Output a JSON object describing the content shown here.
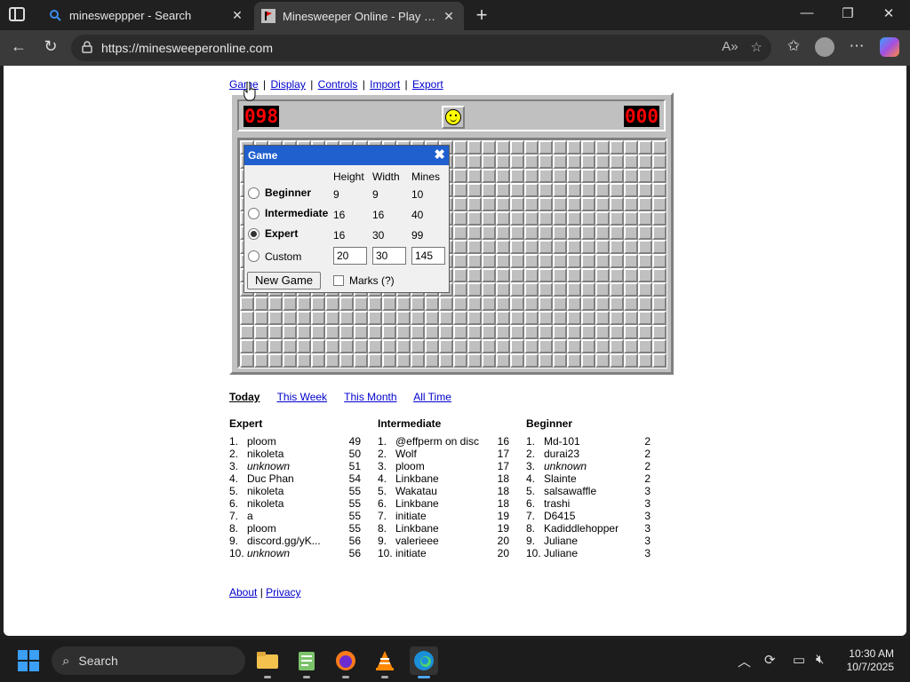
{
  "browser": {
    "tabs": [
      {
        "label": "minesweppper - Search"
      },
      {
        "label": "Minesweeper Online - Play Free Online"
      }
    ],
    "url": "https://minesweeperonline.com"
  },
  "menu": {
    "items": [
      "Game",
      "Display",
      "Controls",
      "Import",
      "Export"
    ],
    "separator": "|"
  },
  "game": {
    "mines_counter": "098",
    "timer": "000",
    "rows": 16,
    "cols": 30
  },
  "dialog": {
    "title": "Game",
    "close": "✖",
    "headers": {
      "height": "Height",
      "width": "Width",
      "mines": "Mines"
    },
    "rows": [
      {
        "label": "Beginner",
        "height": "9",
        "width": "9",
        "mines": "10",
        "checked": false
      },
      {
        "label": "Intermediate",
        "height": "16",
        "width": "16",
        "mines": "40",
        "checked": false
      },
      {
        "label": "Expert",
        "height": "16",
        "width": "30",
        "mines": "99",
        "checked": true
      }
    ],
    "custom": {
      "label": "Custom",
      "height": "20",
      "width": "30",
      "mines": "145"
    },
    "new_game": "New Game",
    "marks": "Marks (?)"
  },
  "scope_tabs": [
    "Today",
    "This Week",
    "This Month",
    "All Time"
  ],
  "leaderboards": {
    "expert": {
      "title": "Expert",
      "entries": [
        {
          "rank": "1.",
          "name": "ploom",
          "score": "49",
          "italic": false
        },
        {
          "rank": "2.",
          "name": "nikoleta",
          "score": "50",
          "italic": false
        },
        {
          "rank": "3.",
          "name": "unknown",
          "score": "51",
          "italic": true
        },
        {
          "rank": "4.",
          "name": "Duc Phan",
          "score": "54",
          "italic": false
        },
        {
          "rank": "5.",
          "name": "nikoleta",
          "score": "55",
          "italic": false
        },
        {
          "rank": "6.",
          "name": "nikoleta",
          "score": "55",
          "italic": false
        },
        {
          "rank": "7.",
          "name": "a",
          "score": "55",
          "italic": false
        },
        {
          "rank": "8.",
          "name": "ploom",
          "score": "55",
          "italic": false
        },
        {
          "rank": "9.",
          "name": "discord.gg/yK...",
          "score": "56",
          "italic": false
        },
        {
          "rank": "10.",
          "name": "unknown",
          "score": "56",
          "italic": true
        }
      ]
    },
    "intermediate": {
      "title": "Intermediate",
      "entries": [
        {
          "rank": "1.",
          "name": "@effperm on disc",
          "score": "16",
          "italic": false
        },
        {
          "rank": "2.",
          "name": "Wolf",
          "score": "17",
          "italic": false
        },
        {
          "rank": "3.",
          "name": "ploom",
          "score": "17",
          "italic": false
        },
        {
          "rank": "4.",
          "name": "Linkbane",
          "score": "18",
          "italic": false
        },
        {
          "rank": "5.",
          "name": "Wakatau",
          "score": "18",
          "italic": false
        },
        {
          "rank": "6.",
          "name": "Linkbane",
          "score": "18",
          "italic": false
        },
        {
          "rank": "7.",
          "name": "initiate",
          "score": "19",
          "italic": false
        },
        {
          "rank": "8.",
          "name": "Linkbane",
          "score": "19",
          "italic": false
        },
        {
          "rank": "9.",
          "name": "valerieee",
          "score": "20",
          "italic": false
        },
        {
          "rank": "10.",
          "name": "initiate",
          "score": "20",
          "italic": false
        }
      ]
    },
    "beginner": {
      "title": "Beginner",
      "entries": [
        {
          "rank": "1.",
          "name": "Md-101",
          "score": "2",
          "italic": false
        },
        {
          "rank": "2.",
          "name": "durai23",
          "score": "2",
          "italic": false
        },
        {
          "rank": "3.",
          "name": "unknown",
          "score": "2",
          "italic": true
        },
        {
          "rank": "4.",
          "name": "Slainte",
          "score": "2",
          "italic": false
        },
        {
          "rank": "5.",
          "name": "salsawaffle",
          "score": "3",
          "italic": false
        },
        {
          "rank": "6.",
          "name": "trashi",
          "score": "3",
          "italic": false
        },
        {
          "rank": "7.",
          "name": "D6415",
          "score": "3",
          "italic": false
        },
        {
          "rank": "8.",
          "name": "Kadiddlehopper",
          "score": "3",
          "italic": false
        },
        {
          "rank": "9.",
          "name": "Juliane",
          "score": "3",
          "italic": false
        },
        {
          "rank": "10.",
          "name": "Juliane",
          "score": "3",
          "italic": false
        }
      ]
    }
  },
  "footer": {
    "about": "About",
    "privacy": "Privacy",
    "separator": "|"
  },
  "taskbar": {
    "search_placeholder": "Search",
    "time": "10:30 AM",
    "date": "10/7/2025"
  }
}
